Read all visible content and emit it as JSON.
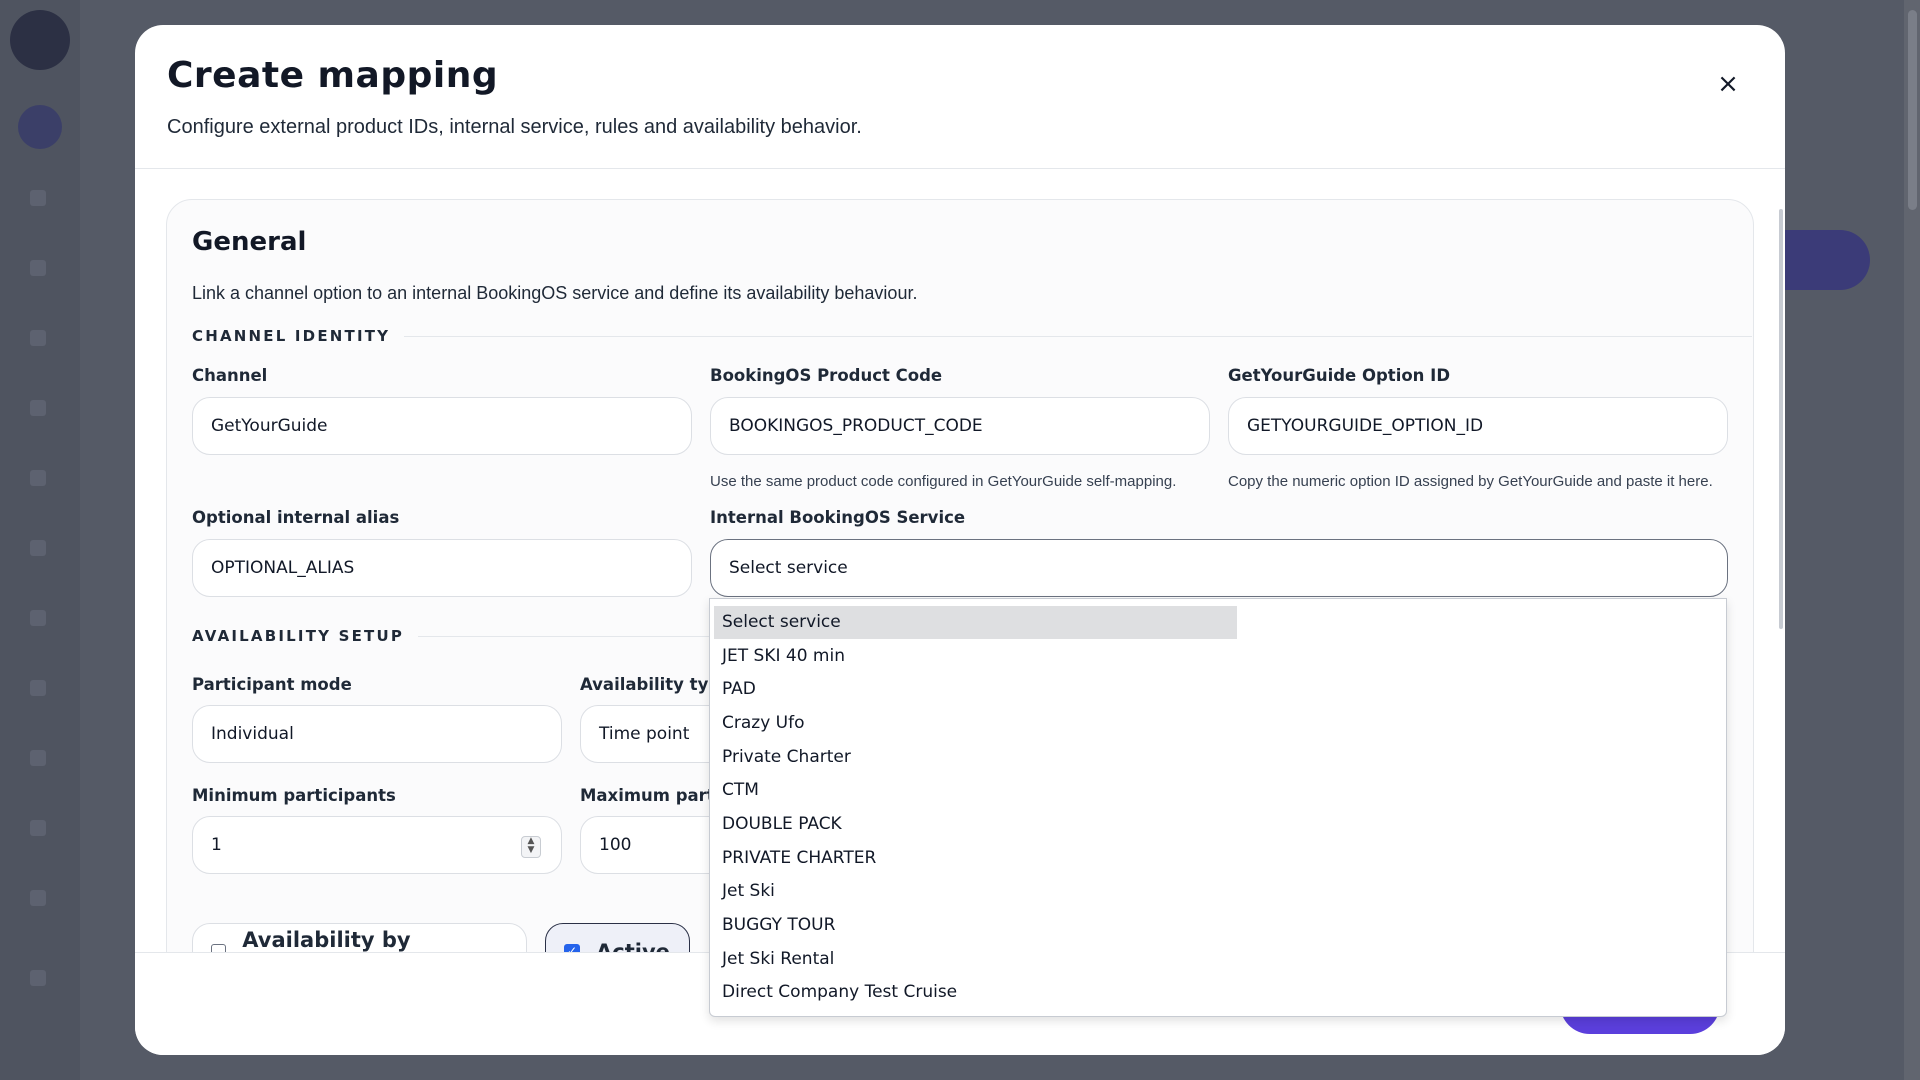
{
  "modal": {
    "title": "Create mapping",
    "subtitle": "Configure external product IDs, internal service, rules and availability behavior.",
    "close_icon": "×"
  },
  "general": {
    "title": "General",
    "description": "Link a channel option to an internal BookingOS service and define its availability behaviour.",
    "channel_identity_label": "CHANNEL IDENTITY",
    "channel": {
      "label": "Channel",
      "value": "GetYourGuide"
    },
    "product_code": {
      "label": "BookingOS Product Code",
      "value": "BOOKINGOS_PRODUCT_CODE",
      "hint": "Use the same product code configured in GetYourGuide self-mapping."
    },
    "option_id": {
      "label": "GetYourGuide Option ID",
      "value": "GETYOURGUIDE_OPTION_ID",
      "hint": "Copy the numeric option ID assigned by GetYourGuide and paste it here."
    },
    "alias": {
      "label": "Optional internal alias",
      "value": "OPTIONAL_ALIAS"
    },
    "service": {
      "label": "Internal BookingOS Service",
      "value": "Select service"
    },
    "availability_setup_label": "AVAILABILITY SETUP",
    "participant_mode": {
      "label": "Participant mode",
      "value": "Individual"
    },
    "availability_type": {
      "label": "Availability typ",
      "value": "Time point"
    },
    "min_participants": {
      "label": "Minimum participants",
      "value": "1"
    },
    "max_participants": {
      "label": "Maximum part",
      "value": "100"
    },
    "availability_by_category": {
      "label": "Availability by category",
      "checked": false
    },
    "active": {
      "label": "Active",
      "checked": true,
      "check_glyph": "✓"
    }
  },
  "dropdown": {
    "options": [
      "Select service",
      "JET SKI 40 min",
      "PAD",
      "Crazy Ufo",
      "Private Charter",
      "CTM",
      "DOUBLE PACK",
      "PRIVATE CHARTER",
      "Jet Ski",
      "BUGGY TOUR",
      "Jet Ski Rental",
      "Direct Company Test Cruise"
    ],
    "selected_index": 0
  },
  "colors": {
    "accent": "#5b3fdc",
    "checkbox": "#2563eb"
  }
}
